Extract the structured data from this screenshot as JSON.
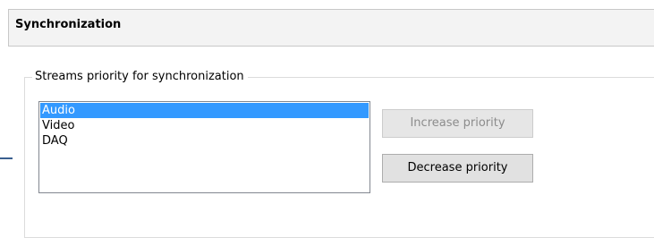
{
  "header": {
    "title": "Synchronization"
  },
  "group": {
    "legend": "Streams priority for synchronization"
  },
  "streams": {
    "items": [
      {
        "label": "Audio",
        "selected": true
      },
      {
        "label": "Video",
        "selected": false
      },
      {
        "label": "DAQ",
        "selected": false
      }
    ]
  },
  "buttons": {
    "increase": {
      "label": "Increase priority",
      "enabled": false
    },
    "decrease": {
      "label": "Decrease priority",
      "enabled": true
    }
  },
  "colors": {
    "selection": "#3399ff",
    "header_background": "#f3f3f3",
    "disabled_text": "#8c8c8c"
  }
}
